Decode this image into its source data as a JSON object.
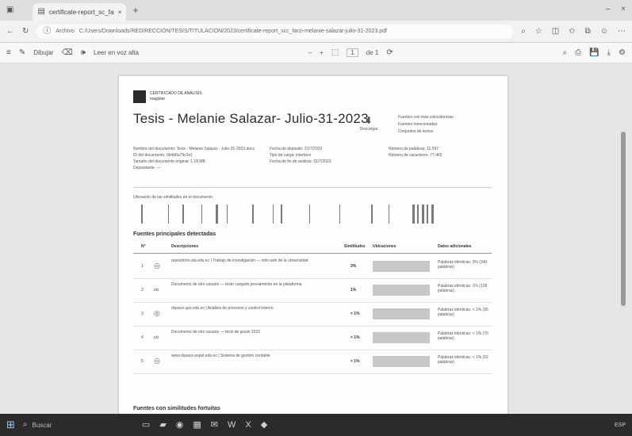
{
  "browser": {
    "tab_title": "certificate-report_sc_farzi-mela",
    "tab_close": "×",
    "new_tab": "+",
    "url_prefix": "Archivo",
    "url": "C:/Users/Downloads/REDIRECCIÓN/TESIS/TITULACIÓN/2023/certificate-report_scc_farzi-melanie-salazar-julio-31-2023.pdf",
    "win_min": "–",
    "win_close": "×"
  },
  "pdf_toolbar": {
    "draw_label": "Dibujar",
    "read_aloud": "Leer en voz alta",
    "zoom_minus": "–",
    "zoom_plus": "+",
    "page_current": "1",
    "page_total": "de 1"
  },
  "document": {
    "logo_line1": "CERTIFICADO DE ANÁLISIS",
    "logo_line2": "magister",
    "title": "Tesis - Melanie Salazar- Julio-31-2023",
    "download_label": "Descargar",
    "option1": "Fuentes con más coincidencias",
    "option2": "Fuentes mencionadas",
    "option3": "Conjuntos de textos",
    "meta_left": [
      "Nombre del documento: Tesis - Melanie Salazar - Julio-31-2023.docx",
      "ID del documento: 0b4d6a79c2e1",
      "Tamaño del documento original: 1,18 MB",
      "Depositante: —"
    ],
    "meta_mid": [
      "Fecha de depósito: 31/7/2023",
      "Tipo de carga: interface",
      "Fecha de fin de análisis: 31/7/2023"
    ],
    "meta_right": [
      "Número de palabras: 11.597",
      "Número de caracteres: 77.465"
    ],
    "barcode_label": "Ubicación de las similitudes en el documento:",
    "section_title": "Fuentes principales detectadas",
    "table_headers": [
      "N°",
      "Descripciones",
      "Similitudes",
      "Ubicaciones",
      "Datos adicionales"
    ],
    "rows": [
      {
        "num": "1",
        "desc": "repositorio.uta.edu.ec | Trabajo de investigación — sitio web de la universidad",
        "coin": "3%",
        "fecha": "Palabras idénticas: 3% (340 palabras)"
      },
      {
        "num": "2",
        "desc": "Documento de otro usuario — texto cargado previamente en la plataforma",
        "coin": "1%",
        "fecha": "Palabras idénticas: 1% (128 palabras)"
      },
      {
        "num": "3",
        "desc": "dspace.ups.edu.ec | Análisis de procesos y control interno",
        "coin": "< 1%",
        "fecha": "Palabras idénticas: < 1% (95 palabras)"
      },
      {
        "num": "4",
        "desc": "Documento de otro usuario — tesis de grado 2022",
        "coin": "< 1%",
        "fecha": "Palabras idénticas: < 1% (70 palabras)"
      },
      {
        "num": "5",
        "desc": "www.dspace.espol.edu.ec | Sistema de gestión contable",
        "coin": "< 1%",
        "fecha": "Palabras idénticas: < 1% (52 palabras)"
      }
    ],
    "section2_title": "Fuentes con similitudes fortuitas"
  },
  "taskbar": {
    "search_label": "Buscar",
    "tray_time": "ESP"
  }
}
